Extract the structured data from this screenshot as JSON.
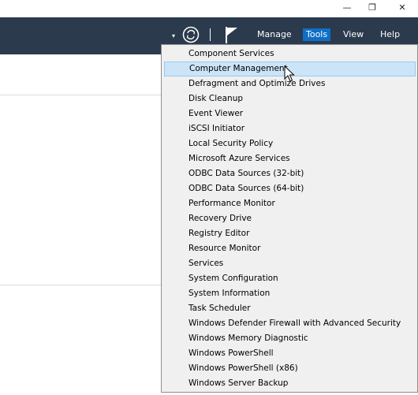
{
  "window": {
    "minimize_glyph": "—",
    "restore_glyph": "❐",
    "close_glyph": "✕"
  },
  "toolbar": {
    "menus": [
      "Manage",
      "Tools",
      "View",
      "Help"
    ],
    "active_menu": "Tools",
    "caret_glyph": "▾",
    "colors": {
      "bar": "#2b3a4d",
      "active_menu": "#0f6fc6"
    }
  },
  "tools_menu": {
    "items": [
      "Component Services",
      "Computer Management",
      "Defragment and Optimize Drives",
      "Disk Cleanup",
      "Event Viewer",
      "iSCSI Initiator",
      "Local Security Policy",
      "Microsoft Azure Services",
      "ODBC Data Sources (32-bit)",
      "ODBC Data Sources (64-bit)",
      "Performance Monitor",
      "Recovery Drive",
      "Registry Editor",
      "Resource Monitor",
      "Services",
      "System Configuration",
      "System Information",
      "Task Scheduler",
      "Windows Defender Firewall with Advanced Security",
      "Windows Memory Diagnostic",
      "Windows PowerShell",
      "Windows PowerShell (x86)",
      "Windows Server Backup"
    ],
    "highlighted": "Computer Management",
    "colors": {
      "highlight": "#cce4f7",
      "highlight_border": "#99c9ef"
    }
  }
}
